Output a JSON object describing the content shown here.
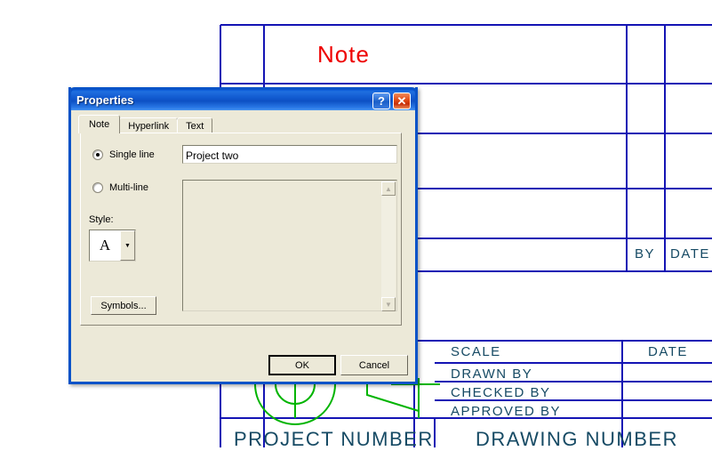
{
  "drawing": {
    "note_text": "Note",
    "accent_color": "#164a64",
    "note_color": "#ee0000",
    "grid_color": "#1414b4",
    "geometry_color": "#00b400",
    "cells": {
      "by": "BY",
      "date_rev": "DATE",
      "scale": "SCALE",
      "date": "DATE",
      "drawn_by": "DRAWN BY",
      "checked_by": "CHECKED BY",
      "approved_by": "APPROVED BY",
      "project_number": "PROJECT NUMBER",
      "drawing_number": "DRAWING NUMBER"
    }
  },
  "dialog": {
    "title": "Properties",
    "help_glyph": "?",
    "close_glyph": "✕",
    "tabs": [
      {
        "label": "Note",
        "active": true
      },
      {
        "label": "Hyperlink",
        "active": false
      },
      {
        "label": "Text",
        "active": false
      }
    ],
    "single_line": {
      "radio_label": "Single line",
      "selected": true,
      "value": "Project two",
      "placeholder": ""
    },
    "multi_line": {
      "radio_label": "Multi-line",
      "selected": false,
      "value": "",
      "scroll_up_glyph": "▲",
      "scroll_down_glyph": "▼"
    },
    "style": {
      "label": "Style:",
      "value": "A",
      "arrow_glyph": "▼"
    },
    "symbols_label": "Symbols...",
    "ok_label": "OK",
    "cancel_label": "Cancel"
  }
}
